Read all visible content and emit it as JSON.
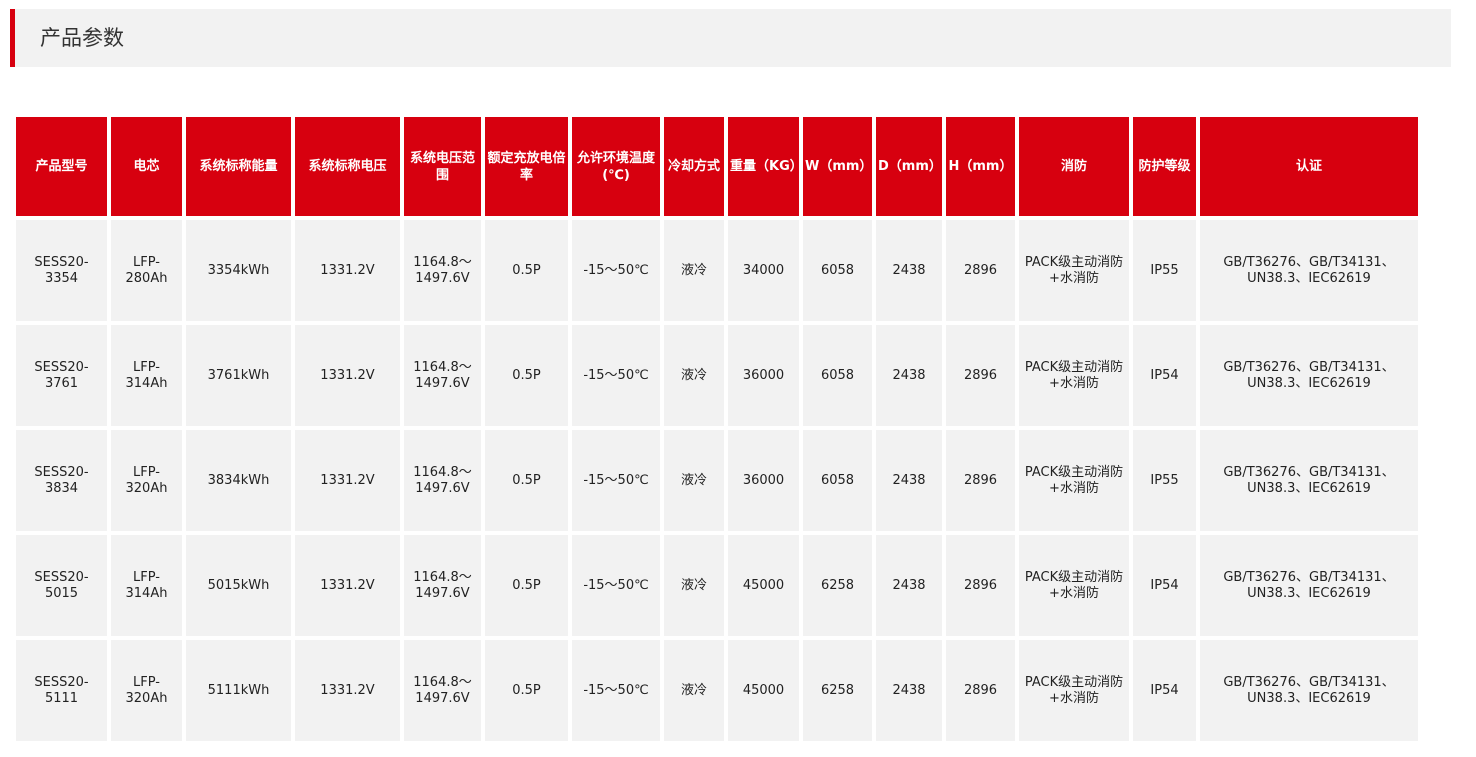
{
  "section": {
    "title": "产品参数"
  },
  "table": {
    "headers": [
      "产品型号",
      "电芯",
      "系统标称能量",
      "系统标称电压",
      "系统电压范围",
      "额定充放电倍率",
      "允许环境温度(℃)",
      "冷却方式",
      "重量（KG）",
      "W（mm）",
      "D（mm）",
      "H（mm）",
      "消防",
      "防护等级",
      "认证"
    ],
    "rows": [
      [
        "SESS20-3354",
        "LFP-280Ah",
        "3354kWh",
        "1331.2V",
        "1164.8～1497.6V",
        "0.5P",
        "-15～50℃",
        "液冷",
        "34000",
        "6058",
        "2438",
        "2896",
        "PACK级主动消防+水消防",
        "IP55",
        "GB/T36276、GB/T34131、UN38.3、IEC62619"
      ],
      [
        "SESS20-3761",
        "LFP-314Ah",
        "3761kWh",
        "1331.2V",
        "1164.8～1497.6V",
        "0.5P",
        "-15～50℃",
        "液冷",
        "36000",
        "6058",
        "2438",
        "2896",
        "PACK级主动消防+水消防",
        "IP54",
        "GB/T36276、GB/T34131、UN38.3、IEC62619"
      ],
      [
        "SESS20-3834",
        "LFP-320Ah",
        "3834kWh",
        "1331.2V",
        "1164.8～1497.6V",
        "0.5P",
        "-15～50℃",
        "液冷",
        "36000",
        "6058",
        "2438",
        "2896",
        "PACK级主动消防+水消防",
        "IP55",
        "GB/T36276、GB/T34131、UN38.3、IEC62619"
      ],
      [
        "SESS20-5015",
        "LFP-314Ah",
        "5015kWh",
        "1331.2V",
        "1164.8～1497.6V",
        "0.5P",
        "-15～50℃",
        "液冷",
        "45000",
        "6258",
        "2438",
        "2896",
        "PACK级主动消防+水消防",
        "IP54",
        "GB/T36276、GB/T34131、UN38.3、IEC62619"
      ],
      [
        "SESS20-5111",
        "LFP-320Ah",
        "5111kWh",
        "1331.2V",
        "1164.8～1497.6V",
        "0.5P",
        "-15～50℃",
        "液冷",
        "45000",
        "6258",
        "2438",
        "2896",
        "PACK级主动消防+水消防",
        "IP54",
        "GB/T36276、GB/T34131、UN38.3、IEC62619"
      ]
    ]
  },
  "colors": {
    "accent": "#d7000f",
    "cell_background": "#f2f2f2",
    "header_text": "#ffffff"
  }
}
